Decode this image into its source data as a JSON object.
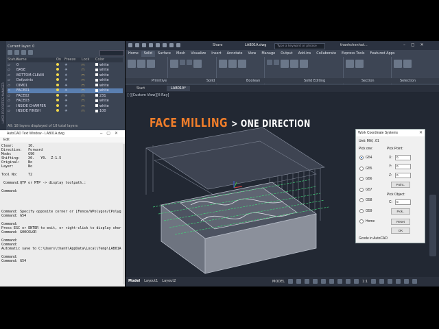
{
  "layer_manager": {
    "current_layer_label": "Current layer: 0",
    "columns": [
      "Status",
      "Name",
      "On",
      "Freeze",
      "Lock",
      "Color"
    ],
    "rows": [
      {
        "name": "0",
        "color": "white",
        "selected": false
      },
      {
        "name": "BASE",
        "color": "white",
        "selected": false
      },
      {
        "name": "BOTTOM-CLEAN",
        "color": "white",
        "selected": false
      },
      {
        "name": "Defpoints",
        "color": "white",
        "selected": false
      },
      {
        "name": "DIM01",
        "color": "white",
        "selected": false
      },
      {
        "name": "FACE01",
        "color": "white",
        "selected": true
      },
      {
        "name": "FACE02",
        "color": "231",
        "selected": false
      },
      {
        "name": "FACE03",
        "color": "white",
        "selected": false
      },
      {
        "name": "INSIDE CHAMFER",
        "color": "white",
        "selected": false
      },
      {
        "name": "INSIDE FINISH",
        "color": "100",
        "selected": false
      }
    ],
    "footer": "All: 18 layers displayed of 18 total layers",
    "side_label": "LAYER PROPERTIES MANAGER"
  },
  "text_window": {
    "title": "AutoCAD Text Window - LAB01A.dwg",
    "menu": "Edit",
    "lines": [
      "Clear:       10.",
      "Direction:   Forward",
      "Mode:        G90",
      "Shifting:    X0.   Y0.  Z-1.5",
      "Original:    No",
      "Layer:       No",
      "",
      "Tool No:     T2",
      "",
      " Command:QTP or MTP -> display toolpath.:",
      "",
      "Command:",
      "",
      "",
      "",
      "",
      "Command: Specify opposite corner or [Fence/WPolygon/CPolyg",
      "Command: G54",
      "",
      "Command:",
      "Press ESC or ENTER to exit, or right-click to display shor",
      "Command: G00COLOR",
      "",
      "Command:",
      "Command:",
      "Automatic save to C:\\Users\\thanh\\AppData\\Local\\Temp\\LAB01A",
      "",
      "Command:",
      "Command: G54"
    ]
  },
  "ribbon": {
    "share": "Share",
    "doc_title": "LAB01A.dwg",
    "search_placeholder": "Type a keyword or phrase",
    "user": "thanhchenhat...",
    "tabs": [
      "Home",
      "Solid",
      "Surface",
      "Mesh",
      "Visualize",
      "Insert",
      "Annotate",
      "View",
      "Manage",
      "Output",
      "Add-ins",
      "Collaborate",
      "Express Tools",
      "Featured Apps"
    ],
    "active_tab": "Solid",
    "panel_labels": [
      "Primitive",
      "Solid",
      "Boolean",
      "Solid Editing",
      "Section",
      "Selection"
    ],
    "doc_tabs": [
      "Start",
      "LAB01A*"
    ]
  },
  "viewport": {
    "view_label": "[-][Custom View][X-Ray]",
    "heading_main": "FACE MILLING",
    "heading_rest": "> ONE DIRECTION"
  },
  "wcs_dialog": {
    "title": "Work Coordinate Systems",
    "unit": "Unit: MM, .01",
    "pick_one": "Pick one:",
    "options": [
      "G54",
      "G55",
      "G56",
      "G57",
      "G58",
      "G59",
      "Home"
    ],
    "selected": "G54",
    "pick_point": "Pick Point:",
    "x_label": "X:",
    "x_val": "0.",
    "y_label": "Y:",
    "y_val": "0.",
    "z_label": "Z:",
    "z_val": "0.",
    "point_btn": "Point..",
    "pick_object": "Pick Object:",
    "c_label": "C:",
    "c_val": "0.",
    "pick_btn": "Pick..",
    "reset_btn": "Reset",
    "ok_btn": "OK",
    "footer": "Gcode in AutoCAD"
  },
  "status_bar": {
    "tabs": [
      "Model",
      "Layout1",
      "Layout2"
    ],
    "active": "Model",
    "model_label": "MODEL",
    "scale": "1:1"
  }
}
